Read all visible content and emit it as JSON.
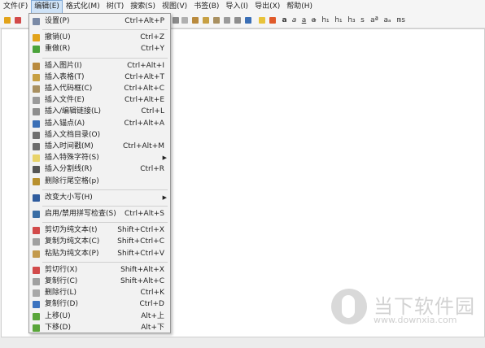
{
  "menubar": [
    "文件(F)",
    "编辑(E)",
    "格式化(M)",
    "树(T)",
    "搜索(S)",
    "视图(V)",
    "书签(B)",
    "导入(I)",
    "导出(X)",
    "帮助(H)"
  ],
  "toolbar": {
    "text_buttons": [
      "a",
      "a",
      "a",
      "a",
      "h₁",
      "h₁",
      "h₃",
      "s",
      "aª",
      "aₐ",
      "ms"
    ],
    "icons": [
      "new-node-icon",
      "new-child-icon",
      "cut-icon",
      "copy-icon",
      "paste-icon",
      "undo-icon",
      "redo-icon",
      "image-icon",
      "table-icon",
      "codebox-icon",
      "attach-icon",
      "link-icon",
      "anchor-icon",
      "color-fg-icon",
      "color-bg-icon"
    ]
  },
  "menu": [
    {
      "type": "item",
      "label": "设置(P)",
      "shortcut": "Ctrl+Alt+P",
      "icon": "settings-icon",
      "color": "#7a8aa6"
    },
    {
      "type": "sep"
    },
    {
      "type": "item",
      "label": "撤销(U)",
      "shortcut": "Ctrl+Z",
      "icon": "undo-icon",
      "color": "#e2a31a"
    },
    {
      "type": "item",
      "label": "重做(R)",
      "shortcut": "Ctrl+Y",
      "icon": "redo-icon",
      "color": "#4aa33a"
    },
    {
      "type": "sep"
    },
    {
      "type": "item",
      "label": "插入图片(I)",
      "shortcut": "Ctrl+Alt+I",
      "icon": "image-icon",
      "color": "#b98a3d"
    },
    {
      "type": "item",
      "label": "插入表格(T)",
      "shortcut": "Ctrl+Alt+T",
      "icon": "table-icon",
      "color": "#c7a043"
    },
    {
      "type": "item",
      "label": "插入代码框(C)",
      "shortcut": "Ctrl+Alt+C",
      "icon": "codebox-icon",
      "color": "#a99060"
    },
    {
      "type": "item",
      "label": "插入文件(E)",
      "shortcut": "Ctrl+Alt+E",
      "icon": "attach-icon",
      "color": "#9a9a9a"
    },
    {
      "type": "item",
      "label": "插入/编辑链接(L)",
      "shortcut": "Ctrl+L",
      "icon": "link-icon",
      "color": "#8e8e8e"
    },
    {
      "type": "item",
      "label": "插入锚点(A)",
      "shortcut": "Ctrl+Alt+A",
      "icon": "anchor-icon",
      "color": "#3b6fb6"
    },
    {
      "type": "item",
      "label": "插入文档目录(O)",
      "shortcut": "",
      "icon": "toc-icon",
      "color": "#707070"
    },
    {
      "type": "item",
      "label": "插入时间戳(M)",
      "shortcut": "Ctrl+Alt+M",
      "icon": "clock-icon",
      "color": "#6d6d6d"
    },
    {
      "type": "item",
      "label": "插入特殊字符(S)",
      "shortcut": "",
      "icon": "special-char-icon",
      "color": "#e8d36a",
      "submenu": true
    },
    {
      "type": "item",
      "label": "插入分割线(R)",
      "shortcut": "Ctrl+R",
      "icon": "hr-icon",
      "color": "#555555"
    },
    {
      "type": "item",
      "label": "删除行尾空格(p)",
      "shortcut": "",
      "icon": "strip-icon",
      "color": "#b8902e"
    },
    {
      "type": "sep"
    },
    {
      "type": "item",
      "label": "改变大小写(H)",
      "shortcut": "",
      "icon": "case-icon",
      "color": "#2f5c9e",
      "submenu": true
    },
    {
      "type": "sep"
    },
    {
      "type": "item",
      "label": "启用/禁用拼写检查(S)",
      "shortcut": "Ctrl+Alt+S",
      "icon": "spellcheck-icon",
      "color": "#3a6ea5"
    },
    {
      "type": "sep"
    },
    {
      "type": "item",
      "label": "剪切为纯文本(t)",
      "shortcut": "Shift+Ctrl+X",
      "icon": "cut-icon",
      "color": "#d24a4a"
    },
    {
      "type": "item",
      "label": "复制为纯文本(C)",
      "shortcut": "Shift+Ctrl+C",
      "icon": "copy-icon",
      "color": "#a0a0a0"
    },
    {
      "type": "item",
      "label": "粘贴为纯文本(P)",
      "shortcut": "Shift+Ctrl+V",
      "icon": "paste-icon",
      "color": "#c39a4d"
    },
    {
      "type": "sep"
    },
    {
      "type": "item",
      "label": "剪切行(X)",
      "shortcut": "Shift+Alt+X",
      "icon": "cut-line-icon",
      "color": "#d24a4a"
    },
    {
      "type": "item",
      "label": "复制行(C)",
      "shortcut": "Shift+Alt+C",
      "icon": "copy-line-icon",
      "color": "#a0a0a0"
    },
    {
      "type": "item",
      "label": "删除行(L)",
      "shortcut": "Ctrl+K",
      "icon": "delete-line-icon",
      "color": "#a8a8a8"
    },
    {
      "type": "item",
      "label": "复制行(D)",
      "shortcut": "Ctrl+D",
      "icon": "duplicate-line-icon",
      "color": "#3b73c0"
    },
    {
      "type": "item",
      "label": "上移(U)",
      "shortcut": "Alt+上",
      "icon": "move-up-icon",
      "color": "#5aa63a"
    },
    {
      "type": "item",
      "label": "下移(D)",
      "shortcut": "Alt+下",
      "icon": "move-down-icon",
      "color": "#5aa63a"
    }
  ],
  "watermark": {
    "name": "当下软件园",
    "url": "www.downxia.com"
  }
}
